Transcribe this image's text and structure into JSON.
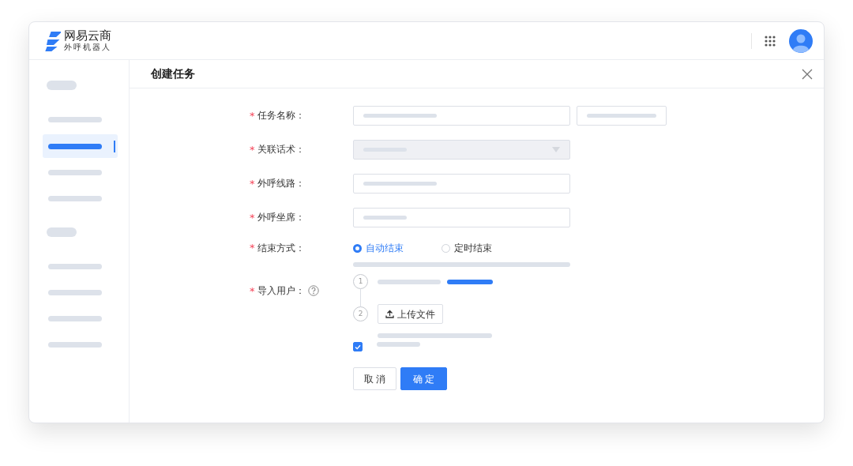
{
  "app": {
    "logo_title": "网易云商",
    "logo_subtitle": "外呼机器人"
  },
  "sidebar": {
    "items": [
      {
        "kind": "group",
        "selected": false
      },
      {
        "kind": "item",
        "selected": false
      },
      {
        "kind": "item",
        "selected": true
      },
      {
        "kind": "item",
        "selected": false
      },
      {
        "kind": "item",
        "selected": false
      },
      {
        "kind": "group",
        "selected": false
      },
      {
        "kind": "item",
        "selected": false
      },
      {
        "kind": "item",
        "selected": false
      },
      {
        "kind": "item",
        "selected": false
      },
      {
        "kind": "item",
        "selected": false
      }
    ]
  },
  "dialog": {
    "title": "创建任务"
  },
  "form": {
    "fields": [
      {
        "label": "任务名称：",
        "required_mark": "*",
        "kind": "input-pair",
        "disabled": false
      },
      {
        "label": "关联话术：",
        "required_mark": "*",
        "kind": "select",
        "disabled": true
      },
      {
        "label": "外呼线路：",
        "required_mark": "*",
        "kind": "input",
        "disabled": false
      },
      {
        "label": "外呼坐席：",
        "required_mark": "*",
        "kind": "input",
        "disabled": false
      },
      {
        "label": "结束方式：",
        "required_mark": "*",
        "kind": "radio",
        "options": [
          {
            "label": "自动结束",
            "selected": true
          },
          {
            "label": "定时结束",
            "selected": false
          }
        ]
      },
      {
        "label": "导入用户：",
        "required_mark": "*",
        "kind": "import",
        "help": true,
        "steps": [
          {
            "number": "1"
          },
          {
            "number": "2",
            "button": "上传文件"
          }
        ],
        "checked": true
      }
    ]
  },
  "buttons": [
    {
      "label": "取 消",
      "kind": "secondary"
    },
    {
      "label": "确 定",
      "kind": "primary"
    }
  ]
}
